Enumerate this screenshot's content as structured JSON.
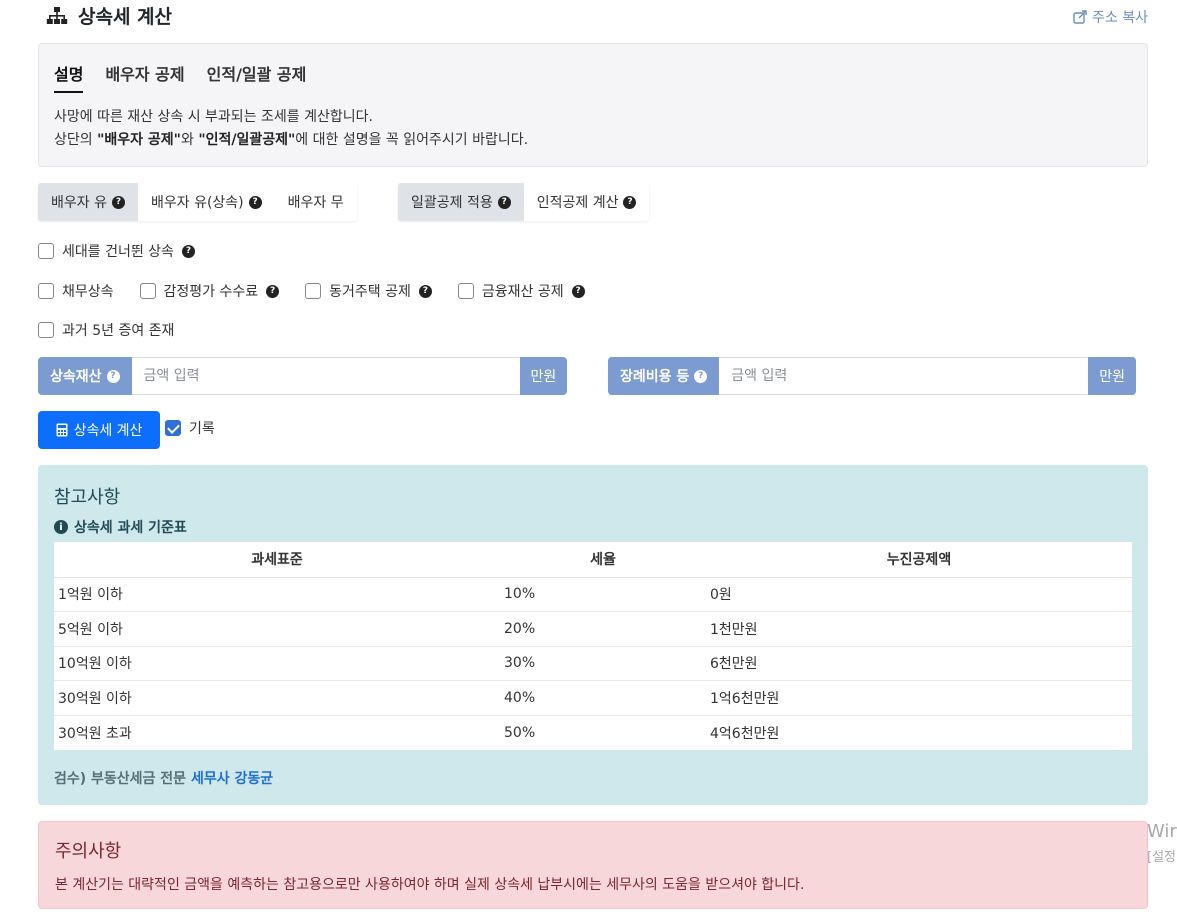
{
  "header": {
    "title": "상속세 계산",
    "copy_label": "주소 복사"
  },
  "tabs": [
    {
      "label": "설명",
      "active": true
    },
    {
      "label": "배우자 공제",
      "active": false
    },
    {
      "label": "인적/일괄 공제",
      "active": false
    }
  ],
  "description": {
    "line1": "사망에 따른 재산 상속 시 부과되는 조세를 계산합니다.",
    "line2_pre": "상단의 ",
    "line2_b1": "\"배우자 공제\"",
    "line2_mid": "와 ",
    "line2_b2": "\"인적/일괄공제\"",
    "line2_post": "에 대한 설명을 꼭 읽어주시기 바랍니다."
  },
  "spouse_options": [
    {
      "label": "배우자 유",
      "help": true,
      "active": true
    },
    {
      "label": "배우자 유(상속)",
      "help": true,
      "active": false
    },
    {
      "label": "배우자 무",
      "help": false,
      "active": false
    }
  ],
  "deduction_options": [
    {
      "label": "일괄공제 적용",
      "help": true,
      "active": true
    },
    {
      "label": "인적공제 계산",
      "help": true,
      "active": false
    }
  ],
  "checkboxes": {
    "skip_generation": "세대를 건너뛴 상속",
    "debt": "채무상속",
    "appraisal_fee": "감정평가 수수료",
    "cohabiting_house": "동거주택 공제",
    "financial_assets": "금융재산 공제",
    "prior_gift": "과거 5년 증여 존재"
  },
  "inputs": {
    "estate": {
      "label": "상속재산",
      "placeholder": "금액 입력",
      "unit": "만원"
    },
    "funeral": {
      "label": "장례비용 등",
      "placeholder": "금액 입력",
      "unit": "만원"
    }
  },
  "calc_button": "상속세 계산",
  "record": {
    "label": "기록",
    "checked": true
  },
  "reference": {
    "heading": "참고사항",
    "table_title": "상속세 과세 기준표",
    "columns": [
      "과세표준",
      "세율",
      "누진공제액"
    ],
    "rows": [
      [
        "1억원 이하",
        "10%",
        "0원"
      ],
      [
        "5억원 이하",
        "20%",
        "1천만원"
      ],
      [
        "10억원 이하",
        "30%",
        "6천만원"
      ],
      [
        "30억원 이하",
        "40%",
        "1억6천만원"
      ],
      [
        "30억원 초과",
        "50%",
        "4억6천만원"
      ]
    ],
    "credit_prefix": "검수) 부동산세금 전문 ",
    "credit_link": "세무사 강동균"
  },
  "warning": {
    "heading": "주의사항",
    "text": "본 계산기는 대략적인 금액을 예측하는 참고용으로만 사용하여야 하며 실제 상속세 납부시에는 세무사의 도움을 받으셔야 합니다."
  },
  "watermark": {
    "line1": "Wir",
    "line2": "[설정"
  },
  "colors": {
    "primary": "#0d6efd",
    "label_blue": "#7b9bd1",
    "info_bg": "#cfe8ec",
    "warn_bg": "#f8d7da"
  }
}
